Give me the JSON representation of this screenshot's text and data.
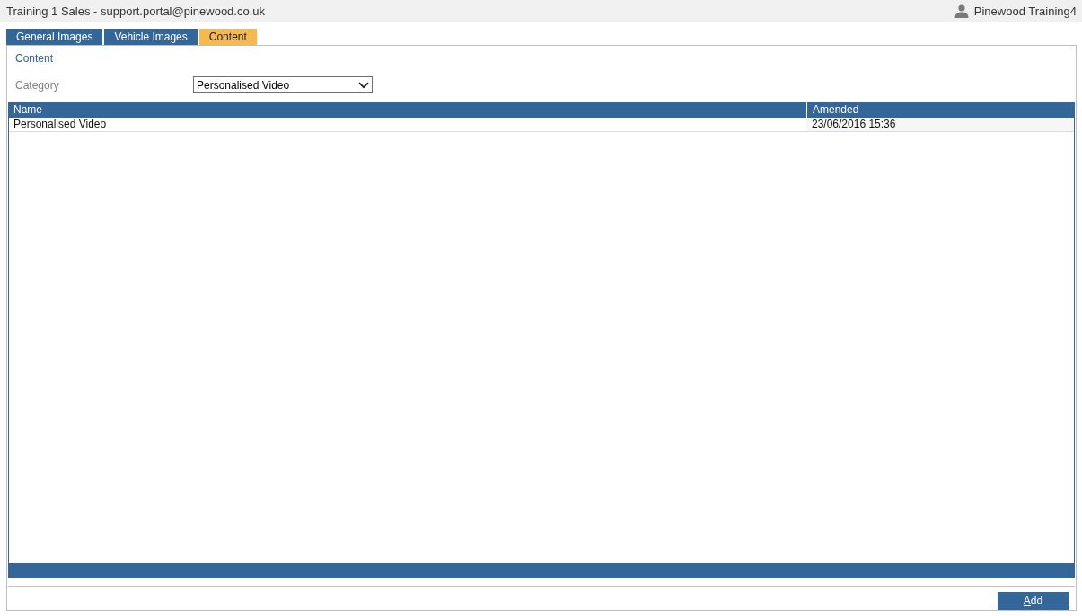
{
  "window": {
    "title": "Training 1 Sales - support.portal@pinewood.co.uk",
    "user": "Pinewood Training4"
  },
  "tabs": [
    {
      "label": "General Images",
      "selected": false
    },
    {
      "label": "Vehicle Images",
      "selected": false
    },
    {
      "label": "Content",
      "selected": true
    }
  ],
  "panel": {
    "heading": "Content",
    "category": {
      "label": "Category",
      "value": "Personalised Video"
    }
  },
  "table": {
    "columns": [
      "Name",
      "Amended"
    ],
    "rows": [
      {
        "cells": [
          "Personalised Video",
          "23/06/2016 15:36"
        ]
      }
    ]
  },
  "buttons": [
    {
      "label": "Add",
      "access_key_underlined": true
    }
  ]
}
